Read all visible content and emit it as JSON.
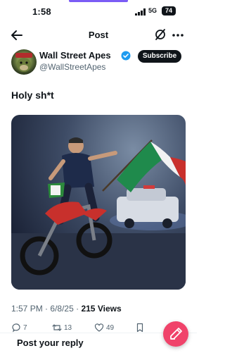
{
  "status": {
    "time": "1:58",
    "network": "5G",
    "battery": "74"
  },
  "header": {
    "title": "Post"
  },
  "author": {
    "name": "Wall Street Apes",
    "handle": "@WallStreetApes",
    "subscribe_label": "Subscribe"
  },
  "post": {
    "text": "Holy sh*t",
    "time": "1:57 PM",
    "date": "6/8/25",
    "views_count": "215",
    "views_label": "Views"
  },
  "actions": {
    "replies": "7",
    "reposts": "13",
    "likes": "49"
  },
  "reply": {
    "placeholder": "Post your reply"
  },
  "colors": {
    "accent": "#1d9bf0",
    "fab": "#f0436a",
    "verified": "#1d9bf0"
  }
}
